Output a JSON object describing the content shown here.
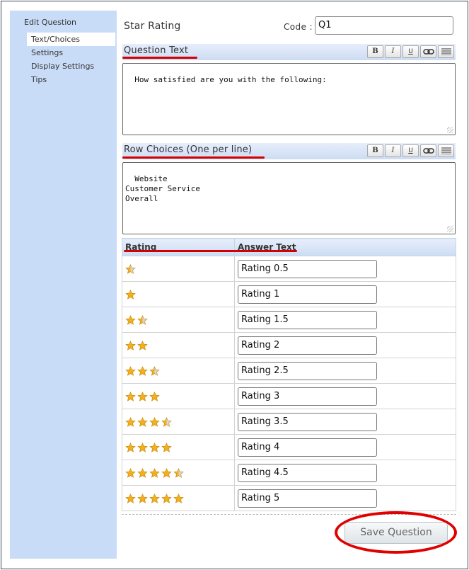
{
  "sidebar": {
    "title": "Edit Question",
    "items": [
      {
        "label": "Text/Choices",
        "active": true
      },
      {
        "label": "Settings",
        "active": false
      },
      {
        "label": "Display Settings",
        "active": false
      },
      {
        "label": "Tips",
        "active": false
      }
    ]
  },
  "header": {
    "question_type": "Star Rating",
    "code_label": "Code :",
    "code_value": "Q1"
  },
  "question_text": {
    "label": "Question Text",
    "value": "How satisfied are you with the following:"
  },
  "row_choices": {
    "label": "Row Choices (One per line)",
    "value": "Website\nCustomer Service\nOverall"
  },
  "toolbar": {
    "bold": "B",
    "italic": "I",
    "underline": "U",
    "link": "link-icon",
    "align": "align-icon"
  },
  "rating_table": {
    "headers": [
      "Rating",
      "Answer Text"
    ],
    "rows": [
      {
        "stars": 0.5,
        "answer": "Rating 0.5"
      },
      {
        "stars": 1,
        "answer": "Rating 1"
      },
      {
        "stars": 1.5,
        "answer": "Rating 1.5"
      },
      {
        "stars": 2,
        "answer": "Rating 2"
      },
      {
        "stars": 2.5,
        "answer": "Rating 2.5"
      },
      {
        "stars": 3,
        "answer": "Rating 3"
      },
      {
        "stars": 3.5,
        "answer": "Rating 3.5"
      },
      {
        "stars": 4,
        "answer": "Rating 4"
      },
      {
        "stars": 4.5,
        "answer": "Rating 4.5"
      },
      {
        "stars": 5,
        "answer": "Rating 5"
      }
    ]
  },
  "save_label": "Save Question",
  "colors": {
    "sidebar_bg": "#c9dcf7",
    "highlight_red": "#d40000",
    "star_gold": "#f2b01e"
  }
}
